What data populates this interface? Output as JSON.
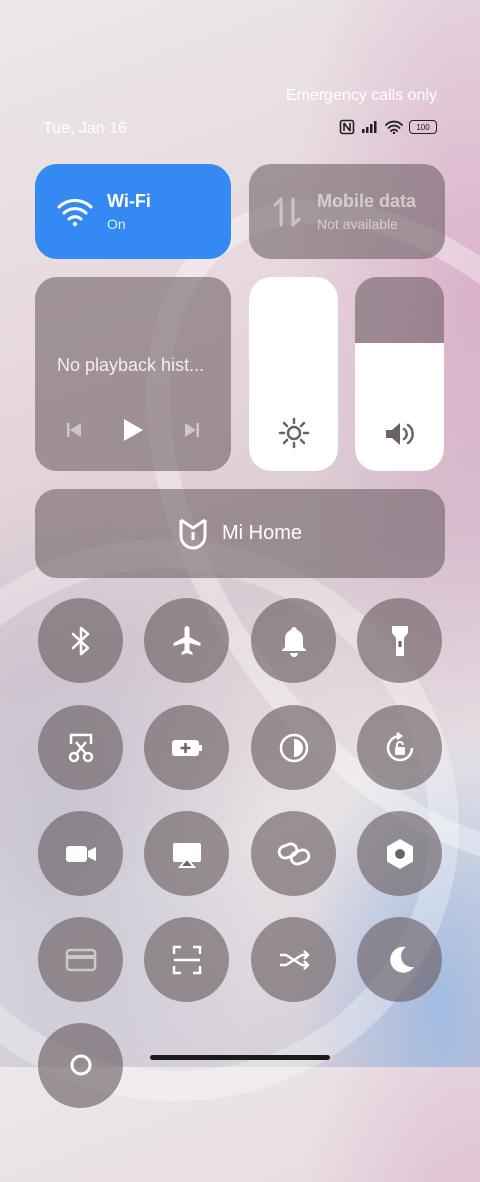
{
  "status": {
    "carrier_text": "Emergency calls only",
    "date": "Tue, Jan 16",
    "battery": "100"
  },
  "wifi_tile": {
    "title": "Wi-Fi",
    "subtitle": "On"
  },
  "mobile_tile": {
    "title": "Mobile data",
    "subtitle": "Not available"
  },
  "media": {
    "text": "No playback hist..."
  },
  "brightness": {
    "level": 1.0
  },
  "volume": {
    "level": 0.66
  },
  "mi_home": {
    "label": "Mi Home"
  },
  "toggles": [
    "bluetooth-icon",
    "airplane-mode-icon",
    "bell-icon",
    "flashlight-icon",
    "screenshot-scissors-icon",
    "battery-saver-icon",
    "dark-mode-icon",
    "rotation-lock-icon",
    "screen-record-icon",
    "cast-icon",
    "link-icon",
    "settings-hexagon-icon",
    "card-icon",
    "scan-icon",
    "shuffle-icon",
    "moon-icon",
    "location-icon"
  ],
  "colors": {
    "accent": "#3589f3",
    "tile": "#64585c"
  }
}
